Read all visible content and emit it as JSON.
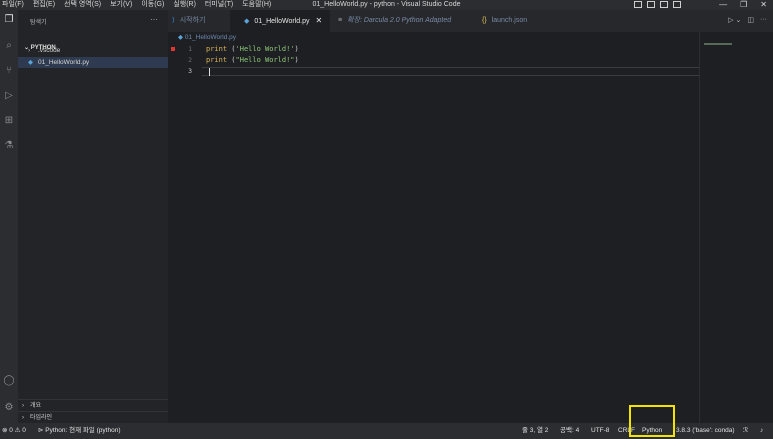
{
  "titlebar": {
    "menu": [
      "파일(F)",
      "편집(E)",
      "선택 영역(S)",
      "보기(V)",
      "이동(G)",
      "실행(R)",
      "터미널(T)",
      "도움말(H)"
    ],
    "window_title": "01_HelloWorld.py - python - Visual Studio Code"
  },
  "activity_bar": {
    "icons": [
      "explorer-icon",
      "search-icon",
      "source-control-icon",
      "run-debug-icon",
      "extensions-icon",
      "testing-icon",
      "account-icon",
      "settings-gear-icon"
    ]
  },
  "sidebar": {
    "header": "탐색기",
    "root": "PYTHON",
    "items": [
      {
        "label": ".vscode",
        "type": "folder"
      },
      {
        "label": "01_HelloWorld.py",
        "type": "file",
        "selected": true
      }
    ],
    "bottom_sections": [
      "개요",
      "타임라인"
    ]
  },
  "tabs": [
    {
      "label": "시작하기",
      "icon": "vscode-logo-icon",
      "active": false
    },
    {
      "label": "01_HelloWorld.py",
      "icon": "python-file-icon",
      "active": true
    },
    {
      "label": "확장: Darcula 2.0 Python Adapted",
      "icon": "extension-icon",
      "active": false
    },
    {
      "label": "launch.json",
      "icon": "json-braces-icon",
      "active": false
    }
  ],
  "breadcrumb": "01_HelloWorld.py",
  "code": {
    "line_numbers": [
      "1",
      "2",
      "3"
    ],
    "lines": [
      {
        "fn": "print",
        "open": " (",
        "arg": "'Hello World!'",
        "close": ")"
      },
      {
        "fn": "print",
        "open": " (",
        "arg": "\"Hello World!\"",
        "close": ")"
      }
    ]
  },
  "statusbar": {
    "problems": "⊗ 0 ⚠ 0",
    "interpreter_file": "Python: 현재 파일 (python)",
    "position": "줄 3, 열 2",
    "spaces": "공백: 4",
    "encoding": "UTF-8",
    "eol": "CRLF",
    "language": "Python",
    "env": "3.8.3 ('base': conda)"
  },
  "colors": {
    "highlight_box": "#f1e400",
    "function_name": "#d8b45a",
    "string": "#8fc97a"
  }
}
